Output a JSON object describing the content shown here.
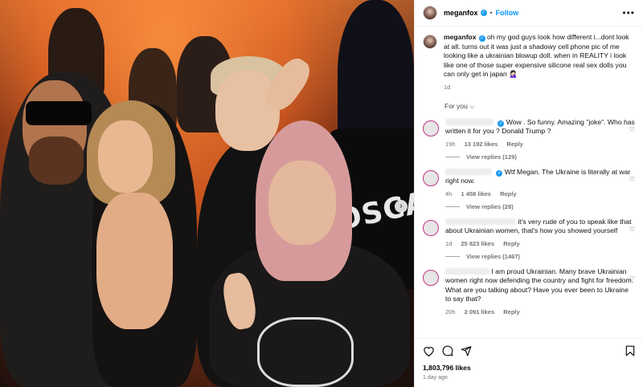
{
  "post": {
    "username": "meganfox",
    "follow_label": "Follow",
    "more_label": "•••",
    "caption": "oh my god guys look how different i...dont look at all. turns out it was just a shadowy cell phone pic of me looking like a ukrainian blowup doll. when in REALITY i look like one of those super expensive silicone real sex dolls you can only get in japan 🤦🏻‍♀️",
    "caption_age": "1d",
    "photo_jacket_text": "OSCAR"
  },
  "comments_section": {
    "sort_label": "For you ⌵",
    "comments": [
      {
        "text": "Wow . So funny. Amazing \"joke\". Who has written it for you ? Donald Trump ?",
        "age": "19h",
        "likes": "13 192 likes",
        "reply_label": "Reply",
        "view_replies": "View replies (129)"
      },
      {
        "text": "Wtf Megan. The Ukraine is literally at war right now.",
        "age": "4h",
        "likes": "1 458 likes",
        "reply_label": "Reply",
        "view_replies": "View replies (28)"
      },
      {
        "text": "it's very rude of you to speak like that about Ukrainian women, that's how you showed yourself",
        "age": "1d",
        "likes": "25 823 likes",
        "reply_label": "Reply",
        "view_replies": "View replies (1467)"
      },
      {
        "text": "I am proud Ukrainian. Many brave Ukrainian women right now defending the country and fight for freedom. What are you talking about? Have you ever been to Ukraine to say that?",
        "age": "20h",
        "likes": "2 091 likes",
        "reply_label": "Reply"
      }
    ]
  },
  "footer": {
    "likes": "1,803,796 likes",
    "time_ago": "1 day ago"
  },
  "icons": {
    "verified": "verified-badge-icon",
    "heart": "heart-icon",
    "comment": "comment-icon",
    "share": "share-icon",
    "save": "bookmark-icon",
    "next": "chevron-right-icon"
  },
  "colors": {
    "accent": "#0095f6",
    "verified": "#1d9bf0",
    "muted_text": "#737373",
    "story_ring": "#c13584"
  }
}
